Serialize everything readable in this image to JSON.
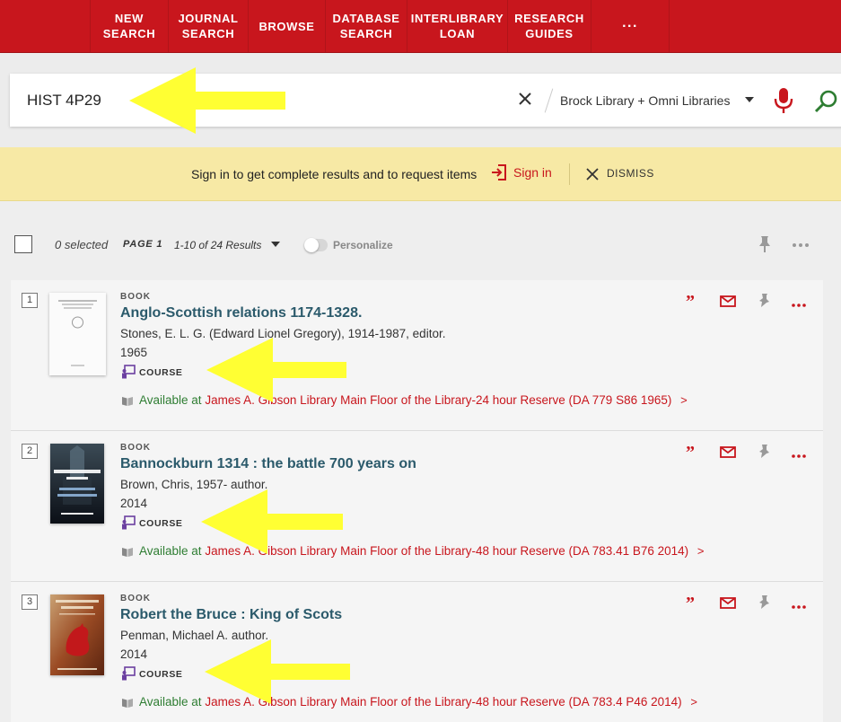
{
  "nav": {
    "items": [
      {
        "label": "NEW\nSEARCH"
      },
      {
        "label": "JOURNAL\nSEARCH"
      },
      {
        "label": "BROWSE"
      },
      {
        "label": "DATABASE\nSEARCH"
      },
      {
        "label": "INTERLIBRARY\nLOAN"
      },
      {
        "label": "RESEARCH\nGUIDES"
      },
      {
        "label": "···"
      }
    ]
  },
  "search": {
    "query": "HIST 4P29",
    "scope": "Brock Library + Omni Libraries"
  },
  "signin_bar": {
    "message": "Sign in to get complete results and to request items",
    "sign_in": "Sign in",
    "dismiss": "DISMISS"
  },
  "toolbar": {
    "selected": "0 selected",
    "page": "PAGE 1",
    "range": "1-10 of 24 Results",
    "personalize": "Personalize"
  },
  "results": [
    {
      "num": "1",
      "type": "BOOK",
      "title": "Anglo-Scottish relations 1174-1328.",
      "author": "Stones, E. L. G. (Edward Lionel Gregory), 1914-1987, editor.",
      "year": "1965",
      "course": "COURSE",
      "status": "Available at",
      "library": "James A. Gibson Library",
      "location": "Main Floor of the Library-24 hour Reserve (DA 779 S86 1965)",
      "chevron": ">"
    },
    {
      "num": "2",
      "type": "BOOK",
      "title": "Bannockburn 1314 : the battle 700 years on",
      "author": "Brown, Chris, 1957- author.",
      "year": "2014",
      "course": "COURSE",
      "status": "Available at",
      "library": "James A. Gibson Library",
      "location": "Main Floor of the Library-48 hour Reserve (DA 783.41 B76 2014)",
      "chevron": ">"
    },
    {
      "num": "3",
      "type": "BOOK",
      "title": "Robert the Bruce : King of Scots",
      "author": "Penman, Michael A. author.",
      "year": "2014",
      "course": "COURSE",
      "status": "Available at",
      "library": "James A. Gibson Library",
      "location": "Main Floor of the Library-48 hour Reserve (DA 783.4 P46 2014)",
      "chevron": ">"
    }
  ],
  "covers": {
    "cover1_text": "Anglo-Scottish Relations 1174-1328 Some Selected Documents",
    "cover2_text": "BANNOCKBURN 1314 THE BATTLE 700 YEARS ON CHRIS BROWN",
    "cover3_title": "Robert the Bruce",
    "cover3_sub": "KING OF THE SCOTS",
    "cover3_author": "MICHAEL PENMAN"
  },
  "colors": {
    "brand": "#c8161d",
    "title": "#2b5a6b",
    "available": "#2e7d32",
    "banner": "#f7e9a5",
    "annotation_arrow": "#ffff33"
  }
}
